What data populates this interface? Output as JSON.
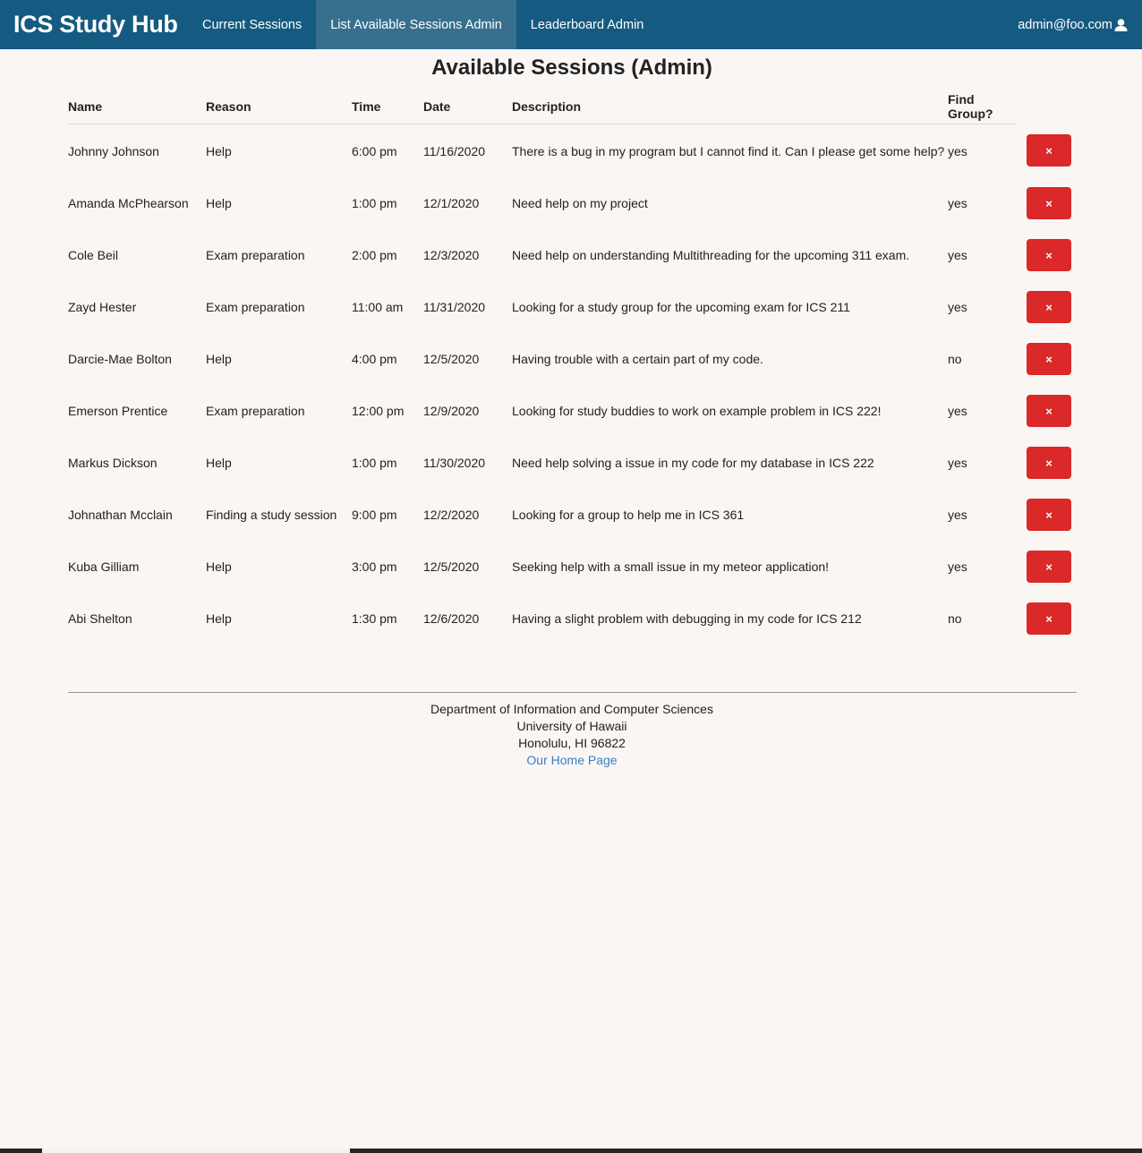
{
  "nav": {
    "brand": "ICS Study Hub",
    "items": [
      {
        "label": "Current Sessions",
        "active": false
      },
      {
        "label": "List Available Sessions Admin",
        "active": true
      },
      {
        "label": "Leaderboard Admin",
        "active": false
      }
    ],
    "user": "admin@foo.com",
    "user_icon": "user-icon"
  },
  "page": {
    "title": "Available Sessions (Admin)"
  },
  "table": {
    "headers": {
      "name": "Name",
      "reason": "Reason",
      "time": "Time",
      "date": "Date",
      "description": "Description",
      "find_group": "Find Group?"
    },
    "delete_icon": "×",
    "rows": [
      {
        "name": "Johnny Johnson",
        "reason": "Help",
        "time": "6:00 pm",
        "date": "11/16/2020",
        "description": "There is a bug in my program but I cannot find it. Can I please get some help?",
        "find_group": "yes"
      },
      {
        "name": "Amanda McPhearson",
        "reason": "Help",
        "time": "1:00 pm",
        "date": "12/1/2020",
        "description": "Need help on my project",
        "find_group": "yes"
      },
      {
        "name": "Cole Beil",
        "reason": "Exam preparation",
        "time": "2:00 pm",
        "date": "12/3/2020",
        "description": "Need help on understanding Multithreading for the upcoming 311 exam.",
        "find_group": "yes"
      },
      {
        "name": "Zayd Hester",
        "reason": "Exam preparation",
        "time": "11:00 am",
        "date": "11/31/2020",
        "description": "Looking for a study group for the upcoming exam for ICS 211",
        "find_group": "yes"
      },
      {
        "name": "Darcie-Mae Bolton",
        "reason": "Help",
        "time": "4:00 pm",
        "date": "12/5/2020",
        "description": "Having trouble with a certain part of my code.",
        "find_group": "no"
      },
      {
        "name": "Emerson Prentice",
        "reason": "Exam preparation",
        "time": "12:00 pm",
        "date": "12/9/2020",
        "description": "Looking for study buddies to work on example problem in ICS 222!",
        "find_group": "yes"
      },
      {
        "name": "Markus Dickson",
        "reason": "Help",
        "time": "1:00 pm",
        "date": "11/30/2020",
        "description": "Need help solving a issue in my code for my database in ICS 222",
        "find_group": "yes"
      },
      {
        "name": "Johnathan Mcclain",
        "reason": "Finding a study session",
        "time": "9:00 pm",
        "date": "12/2/2020",
        "description": "Looking for a group to help me in ICS 361",
        "find_group": "yes"
      },
      {
        "name": "Kuba Gilliam",
        "reason": "Help",
        "time": "3:00 pm",
        "date": "12/5/2020",
        "description": "Seeking help with a small issue in my meteor application!",
        "find_group": "yes"
      },
      {
        "name": "Abi Shelton",
        "reason": "Help",
        "time": "1:30 pm",
        "date": "12/6/2020",
        "description": "Having a slight problem with debugging in my code for ICS 212",
        "find_group": "no"
      }
    ]
  },
  "footer": {
    "line1": "Department of Information and Computer Sciences",
    "line2": "University of Hawaii",
    "line3": "Honolulu, HI 96822",
    "link": "Our Home Page"
  },
  "colors": {
    "navbar": "#155a80",
    "nav_active": "#376f8f",
    "delete_button": "#db2828",
    "background": "#f9f6f4",
    "link": "#3b7fc4"
  }
}
